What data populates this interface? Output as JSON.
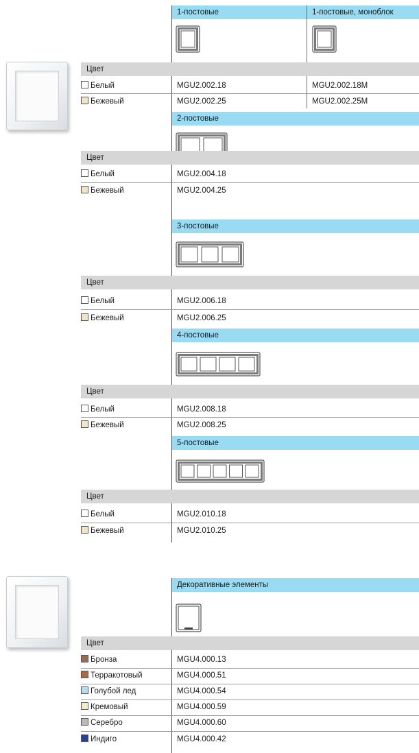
{
  "colors": {
    "header_bg": "#99dbf2",
    "color_row_bg": "#d6d6d6",
    "frame_gray": "#7a7a7a",
    "swatch_white": "#ffffff",
    "swatch_beige": "#f1e4c9"
  },
  "section1": {
    "photo_icon": "frame-photo",
    "col1_header": "1-постовые",
    "col2_header": "1-постовые, моноблок",
    "color_label": "Цвет",
    "rows": [
      {
        "name": "Белый",
        "swatch": "#ffffff",
        "code1": "MGU2.002.18",
        "code2": "MGU2.002.18M"
      },
      {
        "name": "Бежевый",
        "swatch": "#f1e4c9",
        "code1": "MGU2.002.25",
        "code2": "MGU2.002.25M"
      }
    ],
    "groups": [
      {
        "header": "2-постовые",
        "color_label": "Цвет",
        "posts": 2,
        "rows": [
          {
            "name": "Белый",
            "swatch": "#ffffff",
            "code": "MGU2.004.18"
          },
          {
            "name": "Бежевый",
            "swatch": "#f1e4c9",
            "code": "MGU2.004.25"
          }
        ]
      },
      {
        "header": "3-постовые",
        "color_label": "Цвет",
        "posts": 3,
        "rows": [
          {
            "name": "Белый",
            "swatch": "#ffffff",
            "code": "MGU2.006.18"
          },
          {
            "name": "Бежевый",
            "swatch": "#f1e4c9",
            "code": "MGU2.006.25"
          }
        ]
      },
      {
        "header": "4-постовые",
        "color_label": "Цвет",
        "posts": 4,
        "rows": [
          {
            "name": "Белый",
            "swatch": "#ffffff",
            "code": "MGU2.008.18"
          },
          {
            "name": "Бежевый",
            "swatch": "#f1e4c9",
            "code": "MGU2.008.25"
          }
        ]
      },
      {
        "header": "5-постовые",
        "color_label": "Цвет",
        "posts": 5,
        "rows": [
          {
            "name": "Белый",
            "swatch": "#ffffff",
            "code": "MGU2.010.18"
          },
          {
            "name": "Бежевый",
            "swatch": "#f1e4c9",
            "code": "MGU2.010.25"
          }
        ]
      }
    ]
  },
  "section2": {
    "photo_icon": "frame-photo",
    "header": "Декоративные элементы",
    "color_label": "Цвет",
    "rows": [
      {
        "name": "Бронза",
        "swatch": "#9b6b52",
        "code": "MGU4.000.13"
      },
      {
        "name": "Терракотовый",
        "swatch": "#b06a3c",
        "code": "MGU4.000.51"
      },
      {
        "name": "Голубой лед",
        "swatch": "#b9dcf0",
        "code": "MGU4.000.54"
      },
      {
        "name": "Кремовый",
        "swatch": "#f3eccb",
        "code": "MGU4.000.59"
      },
      {
        "name": "Серебро",
        "swatch": "#b9b9b9",
        "code": "MGU4.000.60"
      },
      {
        "name": "Индиго",
        "swatch": "#2a3f9c",
        "code": "MGU4.000.42"
      }
    ]
  }
}
